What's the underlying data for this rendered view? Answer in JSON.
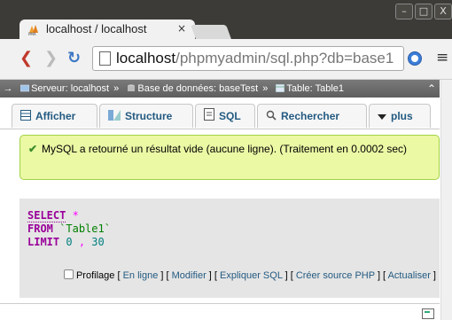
{
  "browser": {
    "tab_title": "localhost / localhost",
    "tab_close": "×",
    "url_host": "localhost",
    "url_path": "/phpmyadmin/sql.php?db=base1",
    "back_icon": "back-arrow-icon",
    "forward_icon": "forward-arrow-icon",
    "reload_icon": "reload-icon",
    "window_controls": [
      "–",
      "□",
      "X"
    ]
  },
  "breadcrumb": {
    "arrow": "→",
    "server": "Serveur: localhost",
    "database": "Base de données: baseTest",
    "table": "Table: Table1",
    "separator": "»",
    "collapse": "⌃"
  },
  "tabs": [
    {
      "label": "Afficher",
      "icon": "table-icon"
    },
    {
      "label": "Structure",
      "icon": "structure-icon"
    },
    {
      "label": "SQL",
      "icon": "sql-icon"
    },
    {
      "label": "Rechercher",
      "icon": "search-icon"
    },
    {
      "label": "plus",
      "icon": "triangle-down-icon"
    }
  ],
  "message": {
    "text": "MySQL a retourné un résultat vide (aucune ligne). (Traitement en 0.0002 sec)",
    "icon": "check-icon",
    "color": "#ebf8a4"
  },
  "sql": {
    "select": "SELECT",
    "star": "*",
    "from": "FROM",
    "table": "`Table1`",
    "limit": "LIMIT",
    "offset": "0",
    "comma": ",",
    "count": "30"
  },
  "actions": {
    "profilage": "Profilage",
    "en_ligne": "En ligne",
    "modifier": "Modifier",
    "expliquer": "Expliquer SQL",
    "creer_php": "Créer source PHP",
    "actualiser": "Actualiser"
  },
  "colors": {
    "link": "#235a81",
    "keyword": "#990099",
    "table": "#008000",
    "number": "#008080",
    "sql_bg": "#e5e5e5"
  }
}
